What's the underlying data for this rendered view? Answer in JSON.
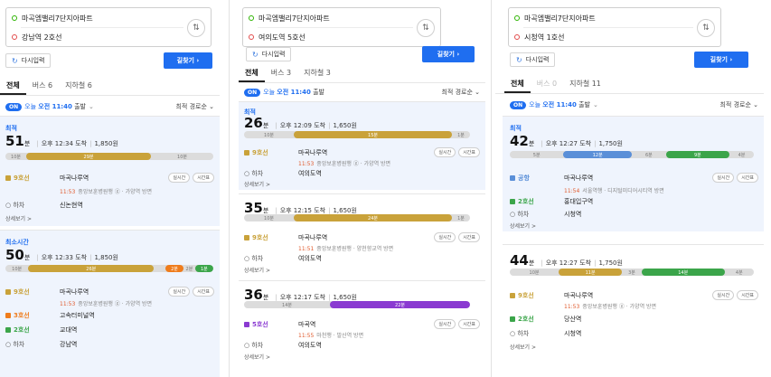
{
  "panels": [
    {
      "origin": "마곡엠밸리7단지아파트",
      "destination": "강남역 2호선",
      "reset_label": "다시입력",
      "go_label": "길찾기 ›",
      "tabs": [
        "전체",
        "버스 6",
        "지하철 6"
      ],
      "filter": {
        "on": "ON",
        "day": "오늘",
        "time": "오전 11:40",
        "suffix": "출발",
        "sort": "최적 경로순 ⌄"
      },
      "cards": [
        {
          "badge": "최적",
          "minutes": "51",
          "unit": "분",
          "arrive": "오후 12:34 도착",
          "fare": "1,850원",
          "bar": [
            {
              "t": "10분",
              "c": "walk",
              "w": 10
            },
            {
              "t": "29분",
              "c": "l9",
              "w": 60
            },
            {
              "t": "10분",
              "c": "walk",
              "w": 30
            }
          ],
          "steps": [
            {
              "line": "9호선",
              "cls": "c9",
              "station": "마곡나루역",
              "p1": "실시간",
              "p2": "시간표"
            },
            {
              "line": "하차",
              "cls": "",
              "station": "신논현역"
            }
          ],
          "sub": {
            "time": "11:53",
            "text": "중앙보훈병원행 ⓖ · 가양역 방면"
          },
          "more": "상세보기 >"
        },
        {
          "badge": "최소시간",
          "minutes": "50",
          "unit": "분",
          "arrive": "오후 12:33 도착",
          "fare": "1,850원",
          "bar": [
            {
              "t": "10분",
              "c": "walk",
              "w": 10
            },
            {
              "t": "26분",
              "c": "l9",
              "w": 55
            },
            {
              "t": "",
              "c": "walk",
              "w": 5
            },
            {
              "t": "2분",
              "c": "l3",
              "w": 8
            },
            {
              "t": "2분",
              "c": "walk",
              "w": 5
            },
            {
              "t": "1분",
              "c": "l2",
              "w": 8
            }
          ],
          "steps": [
            {
              "line": "9호선",
              "cls": "c9",
              "station": "마곡나루역",
              "p1": "실시간",
              "p2": "시간표"
            },
            {
              "line": "3호선",
              "cls": "c3",
              "station": "고속터미널역"
            },
            {
              "line": "2호선",
              "cls": "c2",
              "station": "교대역"
            },
            {
              "line": "하차",
              "cls": "",
              "station": "강남역"
            }
          ],
          "sub": {
            "time": "11:53",
            "text": "중앙보훈병원행 ⓖ · 가양역 방면"
          },
          "more": ""
        }
      ]
    },
    {
      "origin": "마곡엠밸리7단지아파트",
      "destination": "여의도역 5호선",
      "reset_label": "다시입력",
      "go_label": "길찾기 ›",
      "tabs": [
        "전체",
        "버스 3",
        "지하철 3"
      ],
      "filter": {
        "on": "ON",
        "day": "오늘",
        "time": "오전 11:40",
        "suffix": "출발",
        "sort": "최적 경로순 ⌄"
      },
      "cards": [
        {
          "badge": "최적",
          "minutes": "26",
          "unit": "분",
          "arrive": "오후 12:09 도착",
          "fare": "1,650원",
          "bar": [
            {
              "t": "10분",
              "c": "walk",
              "w": 22
            },
            {
              "t": "15분",
              "c": "l9",
              "w": 70
            },
            {
              "t": "1분",
              "c": "walk",
              "w": 8
            }
          ],
          "steps": [
            {
              "line": "9호선",
              "cls": "c9",
              "station": "마곡나루역",
              "p1": "실시간",
              "p2": "시간표"
            },
            {
              "line": "하차",
              "cls": "",
              "station": "여의도역"
            }
          ],
          "sub": {
            "time": "11:53",
            "text": "중앙보훈병원행 ⓖ · 가양역 방면"
          },
          "more": "상세보기 >"
        },
        {
          "badge": "",
          "minutes": "35",
          "unit": "분",
          "arrive": "오후 12:15 도착",
          "fare": "1,650원",
          "bar": [
            {
              "t": "10분",
              "c": "walk",
              "w": 22
            },
            {
              "t": "24분",
              "c": "l9",
              "w": 70
            },
            {
              "t": "1분",
              "c": "walk",
              "w": 8
            }
          ],
          "steps": [
            {
              "line": "9호선",
              "cls": "c9",
              "station": "마곡나루역",
              "p1": "실시간",
              "p2": "시간표"
            },
            {
              "line": "하차",
              "cls": "",
              "station": "여의도역"
            }
          ],
          "sub": {
            "time": "11:51",
            "text": "중앙보훈병원행 · 양천향교역 방면"
          },
          "more": "상세보기 >"
        },
        {
          "badge": "",
          "minutes": "36",
          "unit": "분",
          "arrive": "오후 12:17 도착",
          "fare": "1,650원",
          "bar": [
            {
              "t": "14분",
              "c": "walk",
              "w": 38
            },
            {
              "t": "22분",
              "c": "l5",
              "w": 62
            }
          ],
          "steps": [
            {
              "line": "5호선",
              "cls": "c5",
              "station": "마곡역",
              "p1": "실시간",
              "p2": "시간표"
            },
            {
              "line": "하차",
              "cls": "",
              "station": "여의도역"
            }
          ],
          "sub": {
            "time": "11:55",
            "text": "마천행 · 발산역 방면"
          },
          "more": "상세보기 >"
        }
      ]
    },
    {
      "origin": "마곡엠밸리7단지아파트",
      "destination": "시청역 1호선",
      "reset_label": "다시입력",
      "go_label": "길찾기 ›",
      "tabs": [
        "전체",
        "버스 0",
        "지하철 11"
      ],
      "filter": {
        "on": "ON",
        "day": "오늘",
        "time": "오전 11:40",
        "suffix": "출발",
        "sort": "최적 경로순 ⌄"
      },
      "cards": [
        {
          "badge": "최적",
          "minutes": "42",
          "unit": "분",
          "arrive": "오후 12:27 도착",
          "fare": "1,750원",
          "bar": [
            {
              "t": "5분",
              "c": "walk",
              "w": 22
            },
            {
              "t": "12분",
              "c": "ap",
              "w": 28
            },
            {
              "t": "6분",
              "c": "walk",
              "w": 14
            },
            {
              "t": "9분",
              "c": "l2",
              "w": 26
            },
            {
              "t": "4분",
              "c": "walk",
              "w": 10
            }
          ],
          "steps": [
            {
              "line": "공항",
              "cls": "cap",
              "station": "마곡나루역",
              "p1": "실시간",
              "p2": "시간표"
            },
            {
              "line": "2호선",
              "cls": "c2",
              "station": "홍대입구역"
            },
            {
              "line": "하차",
              "cls": "",
              "station": "시청역"
            }
          ],
          "sub": {
            "time": "11:54",
            "text": "서울역행 · 디지털미디어시티역 방면"
          },
          "more": "상세보기 >"
        },
        {
          "badge": "",
          "minutes": "44",
          "unit": "분",
          "arrive": "오후 12:27 도착",
          "fare": "1,750원",
          "bar": [
            {
              "t": "10분",
              "c": "walk",
              "w": 20
            },
            {
              "t": "11분",
              "c": "l9",
              "w": 26
            },
            {
              "t": "3분",
              "c": "walk",
              "w": 8
            },
            {
              "t": "14분",
              "c": "l2",
              "w": 34
            },
            {
              "t": "4분",
              "c": "walk",
              "w": 12
            }
          ],
          "steps": [
            {
              "line": "9호선",
              "cls": "c9",
              "station": "마곡나루역",
              "p1": "실시간",
              "p2": "시간표"
            },
            {
              "line": "2호선",
              "cls": "c2",
              "station": "당산역"
            },
            {
              "line": "하차",
              "cls": "",
              "station": "시청역"
            }
          ],
          "sub": {
            "time": "11:53",
            "text": "중앙보훈병원행 ⓖ · 가양역 방면"
          },
          "more": "상세보기 >"
        }
      ]
    }
  ]
}
